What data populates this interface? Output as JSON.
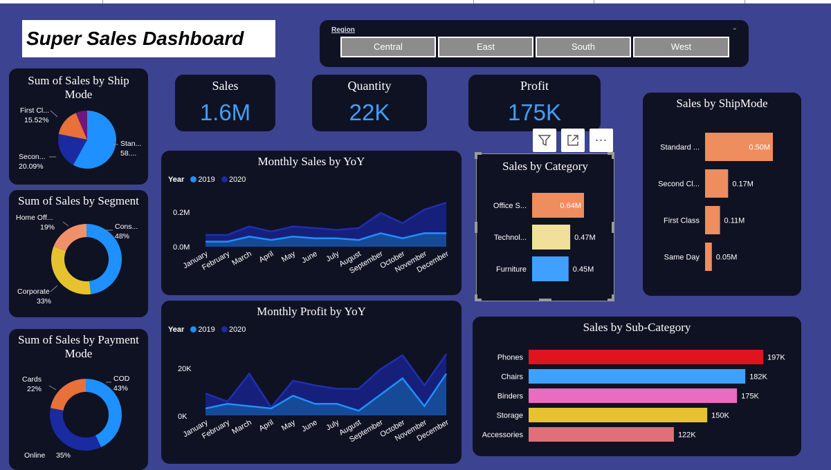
{
  "title": "Super Sales Dashboard",
  "slicer": {
    "label": "Region",
    "options": [
      "Central",
      "East",
      "South",
      "West"
    ]
  },
  "kpis": [
    {
      "label": "Sales",
      "value": "1.6M"
    },
    {
      "label": "Quantity",
      "value": "22K"
    },
    {
      "label": "Profit",
      "value": "175K"
    }
  ],
  "colors": {
    "background": "#3c4390",
    "card": "#0f1223",
    "kpi_value": "#3fa0ff",
    "year_2019": "#1e90ff",
    "year_2020": "#1a2aa0"
  },
  "charts": {
    "ship_mode_pie": {
      "title": "Sum of Sales by Ship Mode",
      "slices": [
        {
          "name": "Standard Class",
          "label": "Stan...",
          "pct_label": "58....",
          "value": 58.0,
          "color": "#1e90ff"
        },
        {
          "name": "Second Class",
          "label": "Secon...",
          "pct_label": "20.09%",
          "value": 20.09,
          "color": "#1a2aa0"
        },
        {
          "name": "First Class",
          "label": "First Cl...",
          "pct_label": "15.52%",
          "value": 15.52,
          "color": "#e8703a"
        },
        {
          "name": "Same Day",
          "label": "",
          "pct_label": "",
          "value": 6.39,
          "color": "#6b1a7a"
        }
      ]
    },
    "segment_donut": {
      "title": "Sum of Sales by Segment",
      "slices": [
        {
          "name": "Consumer",
          "label": "Cons...",
          "pct_label": "48%",
          "value": 48,
          "color": "#1e90ff"
        },
        {
          "name": "Corporate",
          "label": "Corporate",
          "pct_label": "33%",
          "value": 33,
          "color": "#e6c230"
        },
        {
          "name": "Home Office",
          "label": "Home Off...",
          "pct_label": "19%",
          "value": 19,
          "color": "#f0906a"
        }
      ]
    },
    "payment_donut": {
      "title": "Sum of Sales by Payment Mode",
      "slices": [
        {
          "name": "COD",
          "label": "COD",
          "pct_label": "43%",
          "value": 43,
          "color": "#1e90ff"
        },
        {
          "name": "Online",
          "label": "Online",
          "pct_label": "35%",
          "value": 35,
          "color": "#1a2aa0"
        },
        {
          "name": "Cards",
          "label": "Cards",
          "pct_label": "22%",
          "value": 22,
          "color": "#e8703a"
        }
      ]
    },
    "monthly_sales": {
      "title": "Monthly Sales by YoY",
      "legend_title": "Year",
      "yticks": [
        "0.2M",
        "0.0M"
      ],
      "months": [
        "January",
        "February",
        "March",
        "April",
        "May",
        "June",
        "July",
        "August",
        "September",
        "October",
        "November",
        "December"
      ],
      "series": [
        {
          "name": "2019",
          "values": [
            0.03,
            0.03,
            0.06,
            0.04,
            0.06,
            0.05,
            0.05,
            0.04,
            0.08,
            0.05,
            0.08,
            0.08
          ]
        },
        {
          "name": "2020",
          "values": [
            0.07,
            0.07,
            0.12,
            0.09,
            0.12,
            0.11,
            0.1,
            0.11,
            0.2,
            0.14,
            0.22,
            0.26
          ]
        }
      ]
    },
    "monthly_profit": {
      "title": "Monthly Profit by YoY",
      "legend_title": "Year",
      "yticks": [
        "20K",
        "0K"
      ],
      "months": [
        "January",
        "February",
        "March",
        "April",
        "May",
        "June",
        "July",
        "August",
        "September",
        "October",
        "November",
        "December"
      ],
      "series": [
        {
          "name": "2019",
          "values": [
            3000,
            5000,
            4000,
            3000,
            8500,
            5000,
            5000,
            2000,
            9000,
            16000,
            4000,
            18000
          ]
        },
        {
          "name": "2020",
          "values": [
            9500,
            6000,
            18000,
            3500,
            15000,
            13000,
            11500,
            11500,
            20000,
            26000,
            13000,
            26500
          ]
        }
      ]
    },
    "category": {
      "title": "Sales by Category",
      "bars": [
        {
          "label": "Office S...",
          "value_label": "0.64M",
          "value": 0.64,
          "color": "#ee8d5e"
        },
        {
          "label": "Technol...",
          "value_label": "0.47M",
          "value": 0.47,
          "color": "#f0e09a"
        },
        {
          "label": "Furniture",
          "value_label": "0.45M",
          "value": 0.45,
          "color": "#3fa0ff"
        }
      ]
    },
    "shipmode_bar": {
      "title": "Sales by ShipMode",
      "bars": [
        {
          "label": "Standard ...",
          "value_label": "0.50M",
          "value": 0.5
        },
        {
          "label": "Second Cl...",
          "value_label": "0.17M",
          "value": 0.17
        },
        {
          "label": "First Class",
          "value_label": "0.11M",
          "value": 0.11
        },
        {
          "label": "Same Day",
          "value_label": "0.05M",
          "value": 0.05
        }
      ],
      "color": "#ee8d5e"
    },
    "subcategory": {
      "title": "Sales by Sub-Category",
      "bars": [
        {
          "label": "Phones",
          "value_label": "197K",
          "value": 197,
          "color": "#e0141e"
        },
        {
          "label": "Chairs",
          "value_label": "182K",
          "value": 182,
          "color": "#3fa0ff"
        },
        {
          "label": "Binders",
          "value_label": "175K",
          "value": 175,
          "color": "#e86cbf"
        },
        {
          "label": "Storage",
          "value_label": "150K",
          "value": 150,
          "color": "#e6c230"
        },
        {
          "label": "Accessories",
          "value_label": "122K",
          "value": 122,
          "color": "#e06f7a"
        }
      ]
    }
  },
  "toolbar": {
    "icons": [
      "filter-icon",
      "focus-mode-icon",
      "more-options-icon"
    ]
  }
}
